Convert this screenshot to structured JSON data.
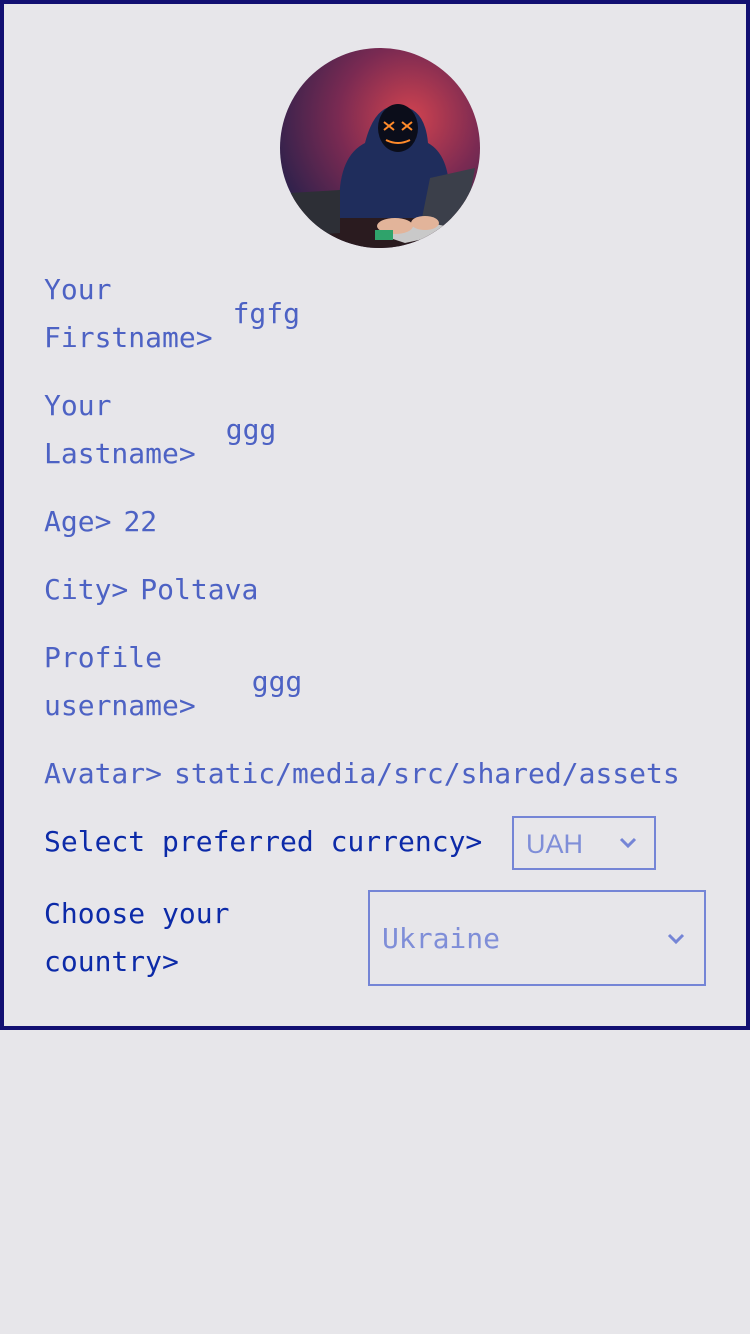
{
  "profile": {
    "firstname_label": "Your\nFirstname>",
    "firstname_value": "fgfg",
    "lastname_label": "Your\nLastname>",
    "lastname_value": "ggg",
    "age_label": "Age>",
    "age_value": "22",
    "city_label": "City>",
    "city_value": "Poltava",
    "username_label": "Profile\nusername>",
    "username_value": "ggg",
    "avatar_label": "Avatar>",
    "avatar_value": "static/media/src/shared/assets"
  },
  "currency": {
    "label": "Select preferred currency>",
    "selected": "UAH"
  },
  "country": {
    "label": "Choose your\ncountry>",
    "selected": "Ukraine"
  },
  "icons": {
    "currency_dropdown": "chevron-down-icon",
    "country_dropdown": "chevron-down-icon"
  },
  "colors": {
    "border": "#120f72",
    "text": "#4d62c4",
    "label_strong": "#0c2aa8",
    "select_border": "#7585d6",
    "background": "#e7e6ea"
  }
}
